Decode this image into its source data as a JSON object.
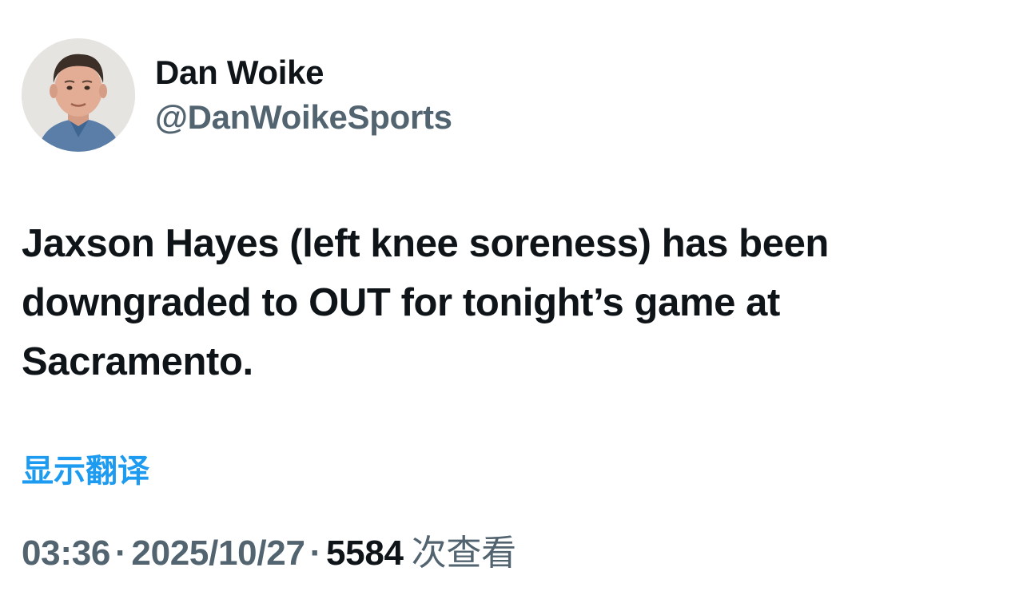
{
  "author": {
    "display_name": "Dan Woike",
    "handle": "@DanWoikeSports"
  },
  "tweet": {
    "text": "Jaxson Hayes (left knee soreness) has been downgraded to OUT for tonight’s game at Sacramento.",
    "translate_label": "显示翻译",
    "time": "03:36",
    "separator": "·",
    "date": "2025/10/27",
    "views_count": "5584",
    "views_label": "次查看"
  },
  "colors": {
    "text_primary": "#0f1419",
    "text_secondary": "#536471",
    "link": "#1d9bf0"
  }
}
